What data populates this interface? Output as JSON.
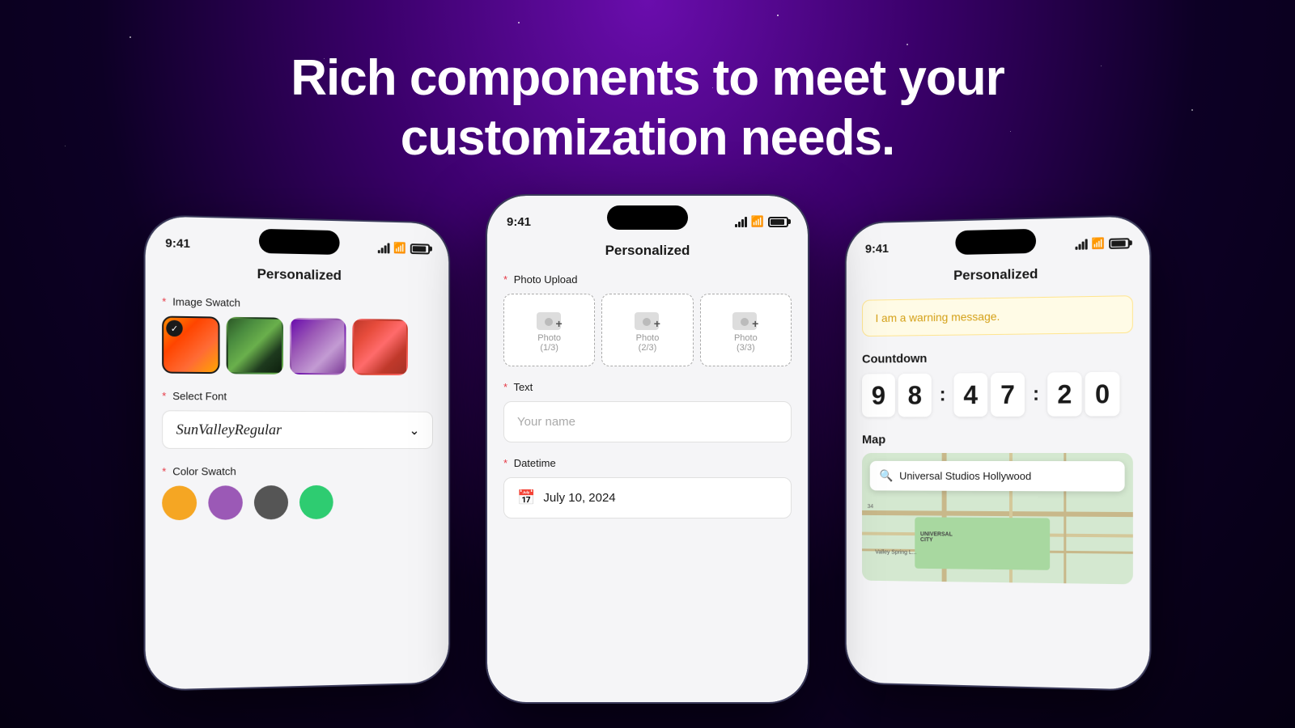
{
  "background": {
    "color": "#0a0020"
  },
  "header": {
    "line1": "Rich components to meet  your",
    "line2": "customization needs."
  },
  "phones": {
    "left": {
      "time": "9:41",
      "title": "Personalized",
      "image_swatch_label": "Image Swatch",
      "swatches": [
        "orange",
        "green",
        "purple",
        "red"
      ],
      "selected_swatch": 0,
      "font_label": "Select Font",
      "font_value": "SunValleyRegular",
      "color_swatch_label": "Color Swatch",
      "colors": [
        "orange",
        "purple",
        "dark",
        "teal"
      ]
    },
    "center": {
      "time": "9:41",
      "title": "Personalized",
      "photo_upload_label": "Photo Upload",
      "photos": [
        "Photo\n(1/3)",
        "Photo\n(2/3)",
        "Photo\n(3/3)"
      ],
      "text_label": "Text",
      "text_placeholder": "Your name",
      "datetime_label": "Datetime",
      "datetime_value": "July 10, 2024"
    },
    "right": {
      "time": "9:41",
      "title": "Personalized",
      "warning_message": "I am a warning message.",
      "countdown_label": "Countdown",
      "digits": [
        "9",
        "8",
        "4",
        "7",
        "2",
        "0"
      ],
      "map_label": "Map",
      "map_search_text": "Universal Studios Hollywood"
    }
  }
}
